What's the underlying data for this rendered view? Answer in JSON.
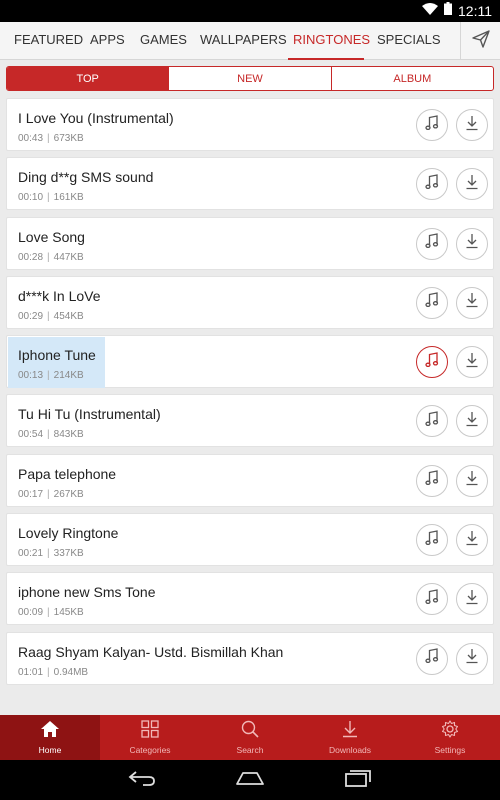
{
  "status_bar": {
    "time": "12:11"
  },
  "top_tabs": [
    {
      "label": "FEATURED",
      "active": false
    },
    {
      "label": "APPS",
      "active": false
    },
    {
      "label": "GAMES",
      "active": false
    },
    {
      "label": "WALLPAPERS",
      "active": false
    },
    {
      "label": "RINGTONES",
      "active": true
    },
    {
      "label": "SPECIALS",
      "active": false
    }
  ],
  "segments": [
    {
      "label": "TOP",
      "active": true
    },
    {
      "label": "NEW",
      "active": false
    },
    {
      "label": "ALBUM",
      "active": false
    }
  ],
  "ringtones": [
    {
      "title": "I Love You (Instrumental)",
      "duration": "00:43",
      "size": "673KB"
    },
    {
      "title": "Ding d**g SMS sound",
      "duration": "00:10",
      "size": "161KB"
    },
    {
      "title": "Love Song",
      "duration": "00:28",
      "size": "447KB"
    },
    {
      "title": "d***k In LoVe",
      "duration": "00:29",
      "size": "454KB"
    },
    {
      "title": "Iphone Tune",
      "duration": "00:13",
      "size": "214KB"
    },
    {
      "title": "Tu Hi Tu (Instrumental)",
      "duration": "00:54",
      "size": "843KB"
    },
    {
      "title": "Papa telephone",
      "duration": "00:17",
      "size": "267KB"
    },
    {
      "title": "Lovely Ringtone",
      "duration": "00:21",
      "size": "337KB"
    },
    {
      "title": "iphone new Sms Tone",
      "duration": "00:09",
      "size": "145KB"
    },
    {
      "title": "Raag Shyam Kalyan- Ustd. Bismillah Khan",
      "duration": "01:01",
      "size": "0.94MB"
    }
  ],
  "meta_separator": "|",
  "bottom_nav": [
    {
      "label": "Home",
      "icon": "home-icon",
      "active": true
    },
    {
      "label": "Categories",
      "icon": "grid-icon",
      "active": false
    },
    {
      "label": "Search",
      "icon": "search-icon",
      "active": false
    },
    {
      "label": "Downloads",
      "icon": "download-icon",
      "active": false
    },
    {
      "label": "Settings",
      "icon": "gear-icon",
      "active": false
    }
  ],
  "colors": {
    "accent": "#c62828",
    "nav_bg": "#b71c1c",
    "nav_active": "#8e1313",
    "highlight": "#d4e8f8"
  }
}
